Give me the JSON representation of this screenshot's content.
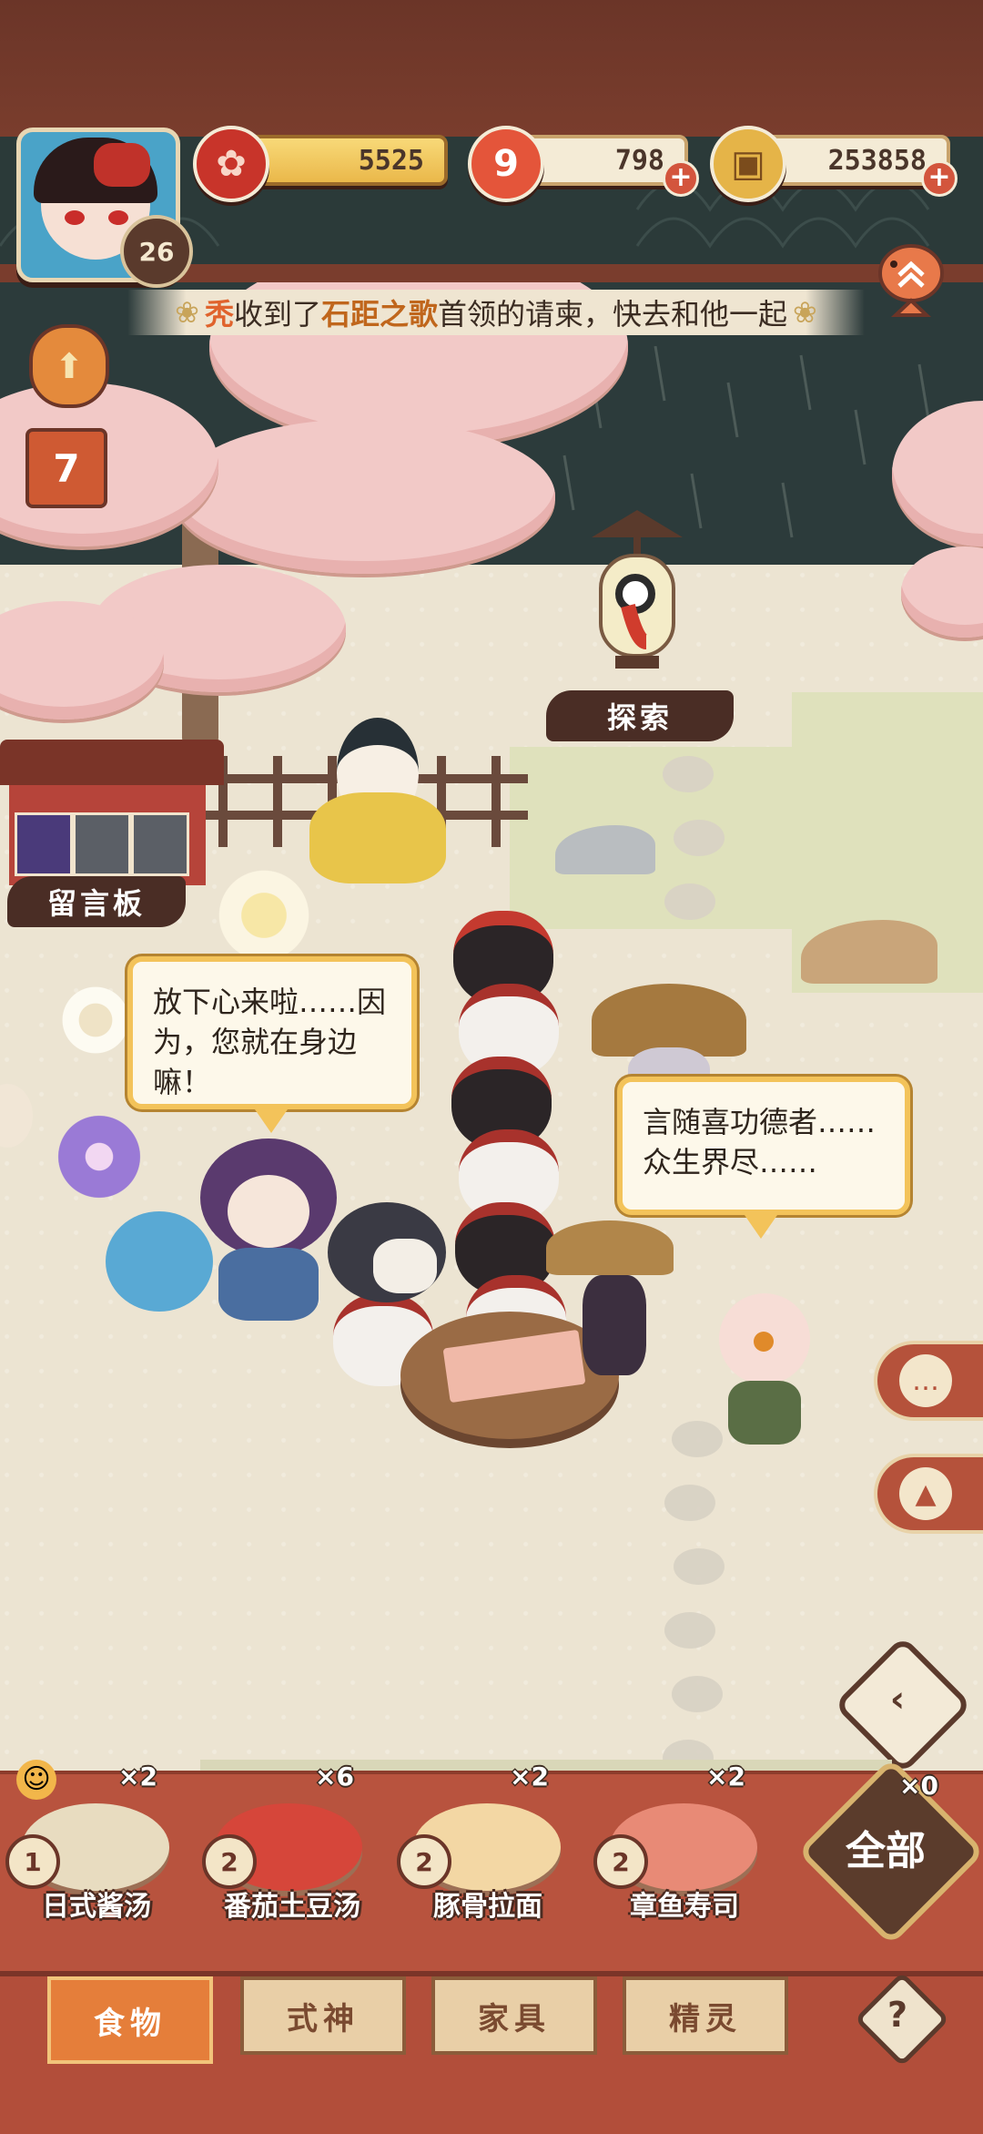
{
  "player": {
    "level": "26"
  },
  "resources": [
    {
      "name": "blossom",
      "value": "5525",
      "icon": "plum-blossom-icon"
    },
    {
      "name": "stamina",
      "value": "798",
      "icon": "magatama-icon"
    },
    {
      "name": "coins",
      "value": "253858",
      "icon": "coin-icon"
    }
  ],
  "notice": {
    "parts": [
      "秃",
      "收到了",
      "石距之歌",
      "首领的请柬，快去和他一起"
    ]
  },
  "calendar": {
    "day": "7"
  },
  "world": {
    "explore_label": "探索",
    "board_label": "留言板"
  },
  "dialogs": {
    "left": "放下心来啦……因为，您就在身边嘛！",
    "right": "言随喜功德者……众生界尽……"
  },
  "foods": [
    {
      "name": "日式酱汤",
      "count": "×2",
      "qty": "1"
    },
    {
      "name": "番茄土豆汤",
      "count": "×6",
      "qty": "2"
    },
    {
      "name": "豚骨拉面",
      "count": "×2",
      "qty": "2"
    },
    {
      "name": "章鱼寿司",
      "count": "×2",
      "qty": "2"
    }
  ],
  "all_button": {
    "label": "全部",
    "count": "×0"
  },
  "tabs": [
    {
      "label": "食物",
      "active": true
    },
    {
      "label": "式神",
      "active": false
    },
    {
      "label": "家具",
      "active": false
    },
    {
      "label": "精灵",
      "active": false
    }
  ],
  "help": "?",
  "colors": {
    "accent": "#b24e3a",
    "active_tab": "#e57e3a",
    "bubble_border": "#f3c35a"
  }
}
